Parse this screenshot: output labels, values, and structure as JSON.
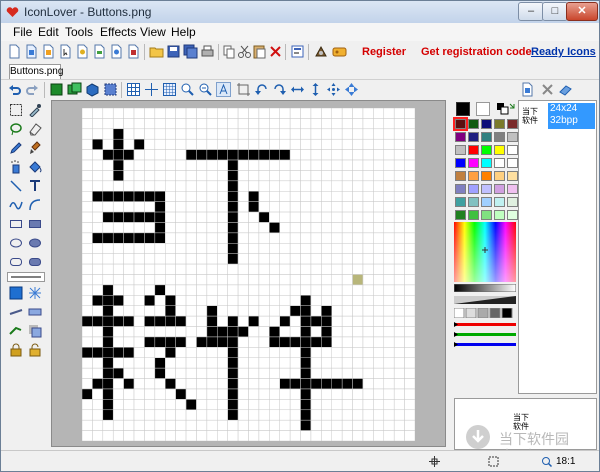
{
  "window": {
    "title": "IconLover - Buttons.png"
  },
  "window_controls": {
    "minimize": "–",
    "maximize": "□",
    "close": "✕"
  },
  "menu": [
    "File",
    "Edit",
    "Tools",
    "Effects",
    "View",
    "Help"
  ],
  "toolbar": {
    "register_label": "Register",
    "get_code_label": "Get registration code",
    "ready_icons_label": "Ready Icons",
    "link_color": "#d40000",
    "ready_icons_color": "#0033aa"
  },
  "document_tab": "Buttons.png",
  "formats": [
    {
      "thumb_line1": "当下",
      "thumb_line2": "软件",
      "size": "24x24",
      "depth": "32bpp"
    }
  ],
  "preview": {
    "line1": "当下",
    "line2": "软件"
  },
  "watermark": {
    "brand": "当下软件园",
    "url": "downxia.com"
  },
  "status": {
    "zoom": "18:1"
  },
  "palette": {
    "foreground": "#000000",
    "background": "#ffffff",
    "selected": "#5a0f0f",
    "swatches": [
      [
        "#5a0f0f",
        "#0e5a0e",
        "#0f0f7a",
        "#7a7a2a",
        "#7a2a2a"
      ],
      [
        "#800080",
        "#1f1f7f",
        "#2f7f7f",
        "#808080",
        "#c0c0c0"
      ],
      [
        "#c0c0c0",
        "#ff0000",
        "#00ff00",
        "#ffff00",
        "#ffffff"
      ],
      [
        "#0000ff",
        "#ff00ff",
        "#00ffff",
        "#ffffff",
        "#ffffff"
      ],
      [
        "#c08040",
        "#ffa040",
        "#ff8000",
        "#ffd080",
        "#ffe0a0"
      ],
      [
        "#8080c0",
        "#a0a0ff",
        "#c0c0ff",
        "#d0a0e0",
        "#f0c0f0"
      ],
      [
        "#40a0a0",
        "#80c0c0",
        "#a0d0ff",
        "#c0f0f0",
        "#e0f0e0"
      ],
      [
        "#208020",
        "#40c040",
        "#80e080",
        "#c0ffc0",
        "#e0ffe0"
      ]
    ]
  },
  "canvas": {
    "grid_size": 32,
    "pixel_color": "#000000",
    "accent_color": "#b8b67a",
    "accent_cell": [
      26,
      16
    ],
    "pixels": [
      [
        3,
        2
      ],
      [
        3,
        3
      ],
      [
        3,
        4
      ],
      [
        3,
        5
      ],
      [
        3,
        6
      ],
      [
        1,
        3
      ],
      [
        2,
        4
      ],
      [
        4,
        4
      ],
      [
        5,
        3
      ],
      [
        1,
        8
      ],
      [
        2,
        8
      ],
      [
        3,
        8
      ],
      [
        4,
        8
      ],
      [
        5,
        8
      ],
      [
        6,
        8
      ],
      [
        7,
        8
      ],
      [
        2,
        10
      ],
      [
        3,
        10
      ],
      [
        4,
        10
      ],
      [
        5,
        10
      ],
      [
        6,
        10
      ],
      [
        7,
        10
      ],
      [
        1,
        12
      ],
      [
        2,
        12
      ],
      [
        3,
        12
      ],
      [
        4,
        12
      ],
      [
        5,
        12
      ],
      [
        6,
        12
      ],
      [
        7,
        12
      ],
      [
        7,
        9
      ],
      [
        7,
        10
      ],
      [
        7,
        11
      ],
      [
        7,
        12
      ],
      [
        10,
        4
      ],
      [
        11,
        4
      ],
      [
        12,
        4
      ],
      [
        13,
        4
      ],
      [
        14,
        4
      ],
      [
        15,
        4
      ],
      [
        16,
        4
      ],
      [
        17,
        4
      ],
      [
        18,
        4
      ],
      [
        19,
        4
      ],
      [
        14,
        5
      ],
      [
        14,
        6
      ],
      [
        14,
        7
      ],
      [
        14,
        8
      ],
      [
        14,
        9
      ],
      [
        14,
        10
      ],
      [
        14,
        11
      ],
      [
        14,
        12
      ],
      [
        14,
        13
      ],
      [
        14,
        14
      ],
      [
        16,
        8
      ],
      [
        16,
        9
      ],
      [
        17,
        10
      ],
      [
        18,
        11
      ],
      [
        2,
        17
      ],
      [
        2,
        18
      ],
      [
        2,
        19
      ],
      [
        2,
        20
      ],
      [
        2,
        21
      ],
      [
        2,
        22
      ],
      [
        2,
        23
      ],
      [
        2,
        24
      ],
      [
        2,
        25
      ],
      [
        2,
        26
      ],
      [
        2,
        27
      ],
      [
        2,
        28
      ],
      [
        2,
        29
      ],
      [
        1,
        18
      ],
      [
        3,
        18
      ],
      [
        0,
        20
      ],
      [
        1,
        20
      ],
      [
        3,
        20
      ],
      [
        4,
        20
      ],
      [
        0,
        23
      ],
      [
        1,
        23
      ],
      [
        3,
        23
      ],
      [
        4,
        23
      ],
      [
        3,
        25
      ],
      [
        4,
        26
      ],
      [
        1,
        26
      ],
      [
        0,
        27
      ],
      [
        6,
        18
      ],
      [
        7,
        17
      ],
      [
        8,
        18
      ],
      [
        8,
        19
      ],
      [
        8,
        20
      ],
      [
        7,
        20
      ],
      [
        6,
        20
      ],
      [
        9,
        20
      ],
      [
        6,
        22
      ],
      [
        7,
        22
      ],
      [
        8,
        22
      ],
      [
        9,
        22
      ],
      [
        8,
        23
      ],
      [
        7,
        24
      ],
      [
        7,
        25
      ],
      [
        8,
        26
      ],
      [
        9,
        27
      ],
      [
        10,
        28
      ],
      [
        12,
        19
      ],
      [
        12,
        20
      ],
      [
        12,
        21
      ],
      [
        13,
        21
      ],
      [
        11,
        22
      ],
      [
        12,
        22
      ],
      [
        14,
        20
      ],
      [
        14,
        21
      ],
      [
        14,
        22
      ],
      [
        14,
        23
      ],
      [
        14,
        24
      ],
      [
        14,
        25
      ],
      [
        14,
        26
      ],
      [
        14,
        27
      ],
      [
        14,
        28
      ],
      [
        14,
        29
      ],
      [
        13,
        22
      ],
      [
        15,
        21
      ],
      [
        16,
        20
      ],
      [
        18,
        21
      ],
      [
        18,
        22
      ],
      [
        19,
        22
      ],
      [
        20,
        22
      ],
      [
        21,
        22
      ],
      [
        22,
        22
      ],
      [
        23,
        22
      ],
      [
        19,
        20
      ],
      [
        20,
        19
      ],
      [
        21,
        18
      ],
      [
        21,
        19
      ],
      [
        21,
        20
      ],
      [
        21,
        21
      ],
      [
        21,
        23
      ],
      [
        21,
        24
      ],
      [
        21,
        25
      ],
      [
        21,
        26
      ],
      [
        21,
        27
      ],
      [
        21,
        28
      ],
      [
        21,
        29
      ],
      [
        21,
        30
      ],
      [
        19,
        26
      ],
      [
        20,
        26
      ],
      [
        22,
        26
      ],
      [
        23,
        26
      ],
      [
        24,
        26
      ],
      [
        25,
        26
      ],
      [
        26,
        26
      ],
      [
        23,
        19
      ],
      [
        23,
        20
      ],
      [
        23,
        21
      ],
      [
        22,
        20
      ]
    ]
  }
}
